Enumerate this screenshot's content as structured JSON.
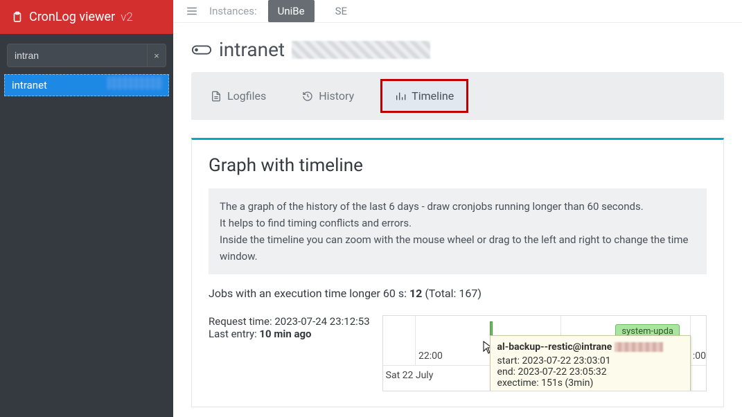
{
  "brand": {
    "name": "CronLog viewer",
    "version": "v2"
  },
  "search": {
    "value": "intran",
    "clear": "×"
  },
  "sidebar": {
    "items": [
      {
        "label": "intranet"
      }
    ]
  },
  "topbar": {
    "instances_label": "Instances:",
    "instances": [
      {
        "label": "UniBe",
        "active": true
      },
      {
        "label": "SE",
        "active": false
      }
    ]
  },
  "page": {
    "title": "intranet"
  },
  "tabs": {
    "logfiles": "Logfiles",
    "history": "History",
    "timeline": "Timeline"
  },
  "panel": {
    "heading": "Graph with timeline",
    "info_line1": "The a graph of the history of the last 6 days - draw cronjobs running longer than 60 seconds.",
    "info_line2": "It helps to find timing conflicts and errors.",
    "info_line3": "Inside the timeline you can zoom with the mouse wheel or drag to the left and right to change the time window.",
    "meta_prefix": "Jobs with an execution time longer 60 s: ",
    "meta_count": "12",
    "meta_total": " (Total: 167)",
    "request_time_label": "Request time: ",
    "request_time": "2023-07-24 23:12:53",
    "last_entry_label": "Last entry: ",
    "last_entry": "10 min ago"
  },
  "timeline": {
    "tick1": "22:00",
    "tick_partial": ":00",
    "date": "Sat 22 July",
    "pill1": "system-upda"
  },
  "tooltip": {
    "title_prefix": "al-backup--restic@intrane",
    "start_label": "start: ",
    "start": "2023-07-22 23:03:01",
    "end_label": "end: ",
    "end": "2023-07-22 23:05:32",
    "exec_label": "exectime: ",
    "exec": "151s (3min)"
  }
}
